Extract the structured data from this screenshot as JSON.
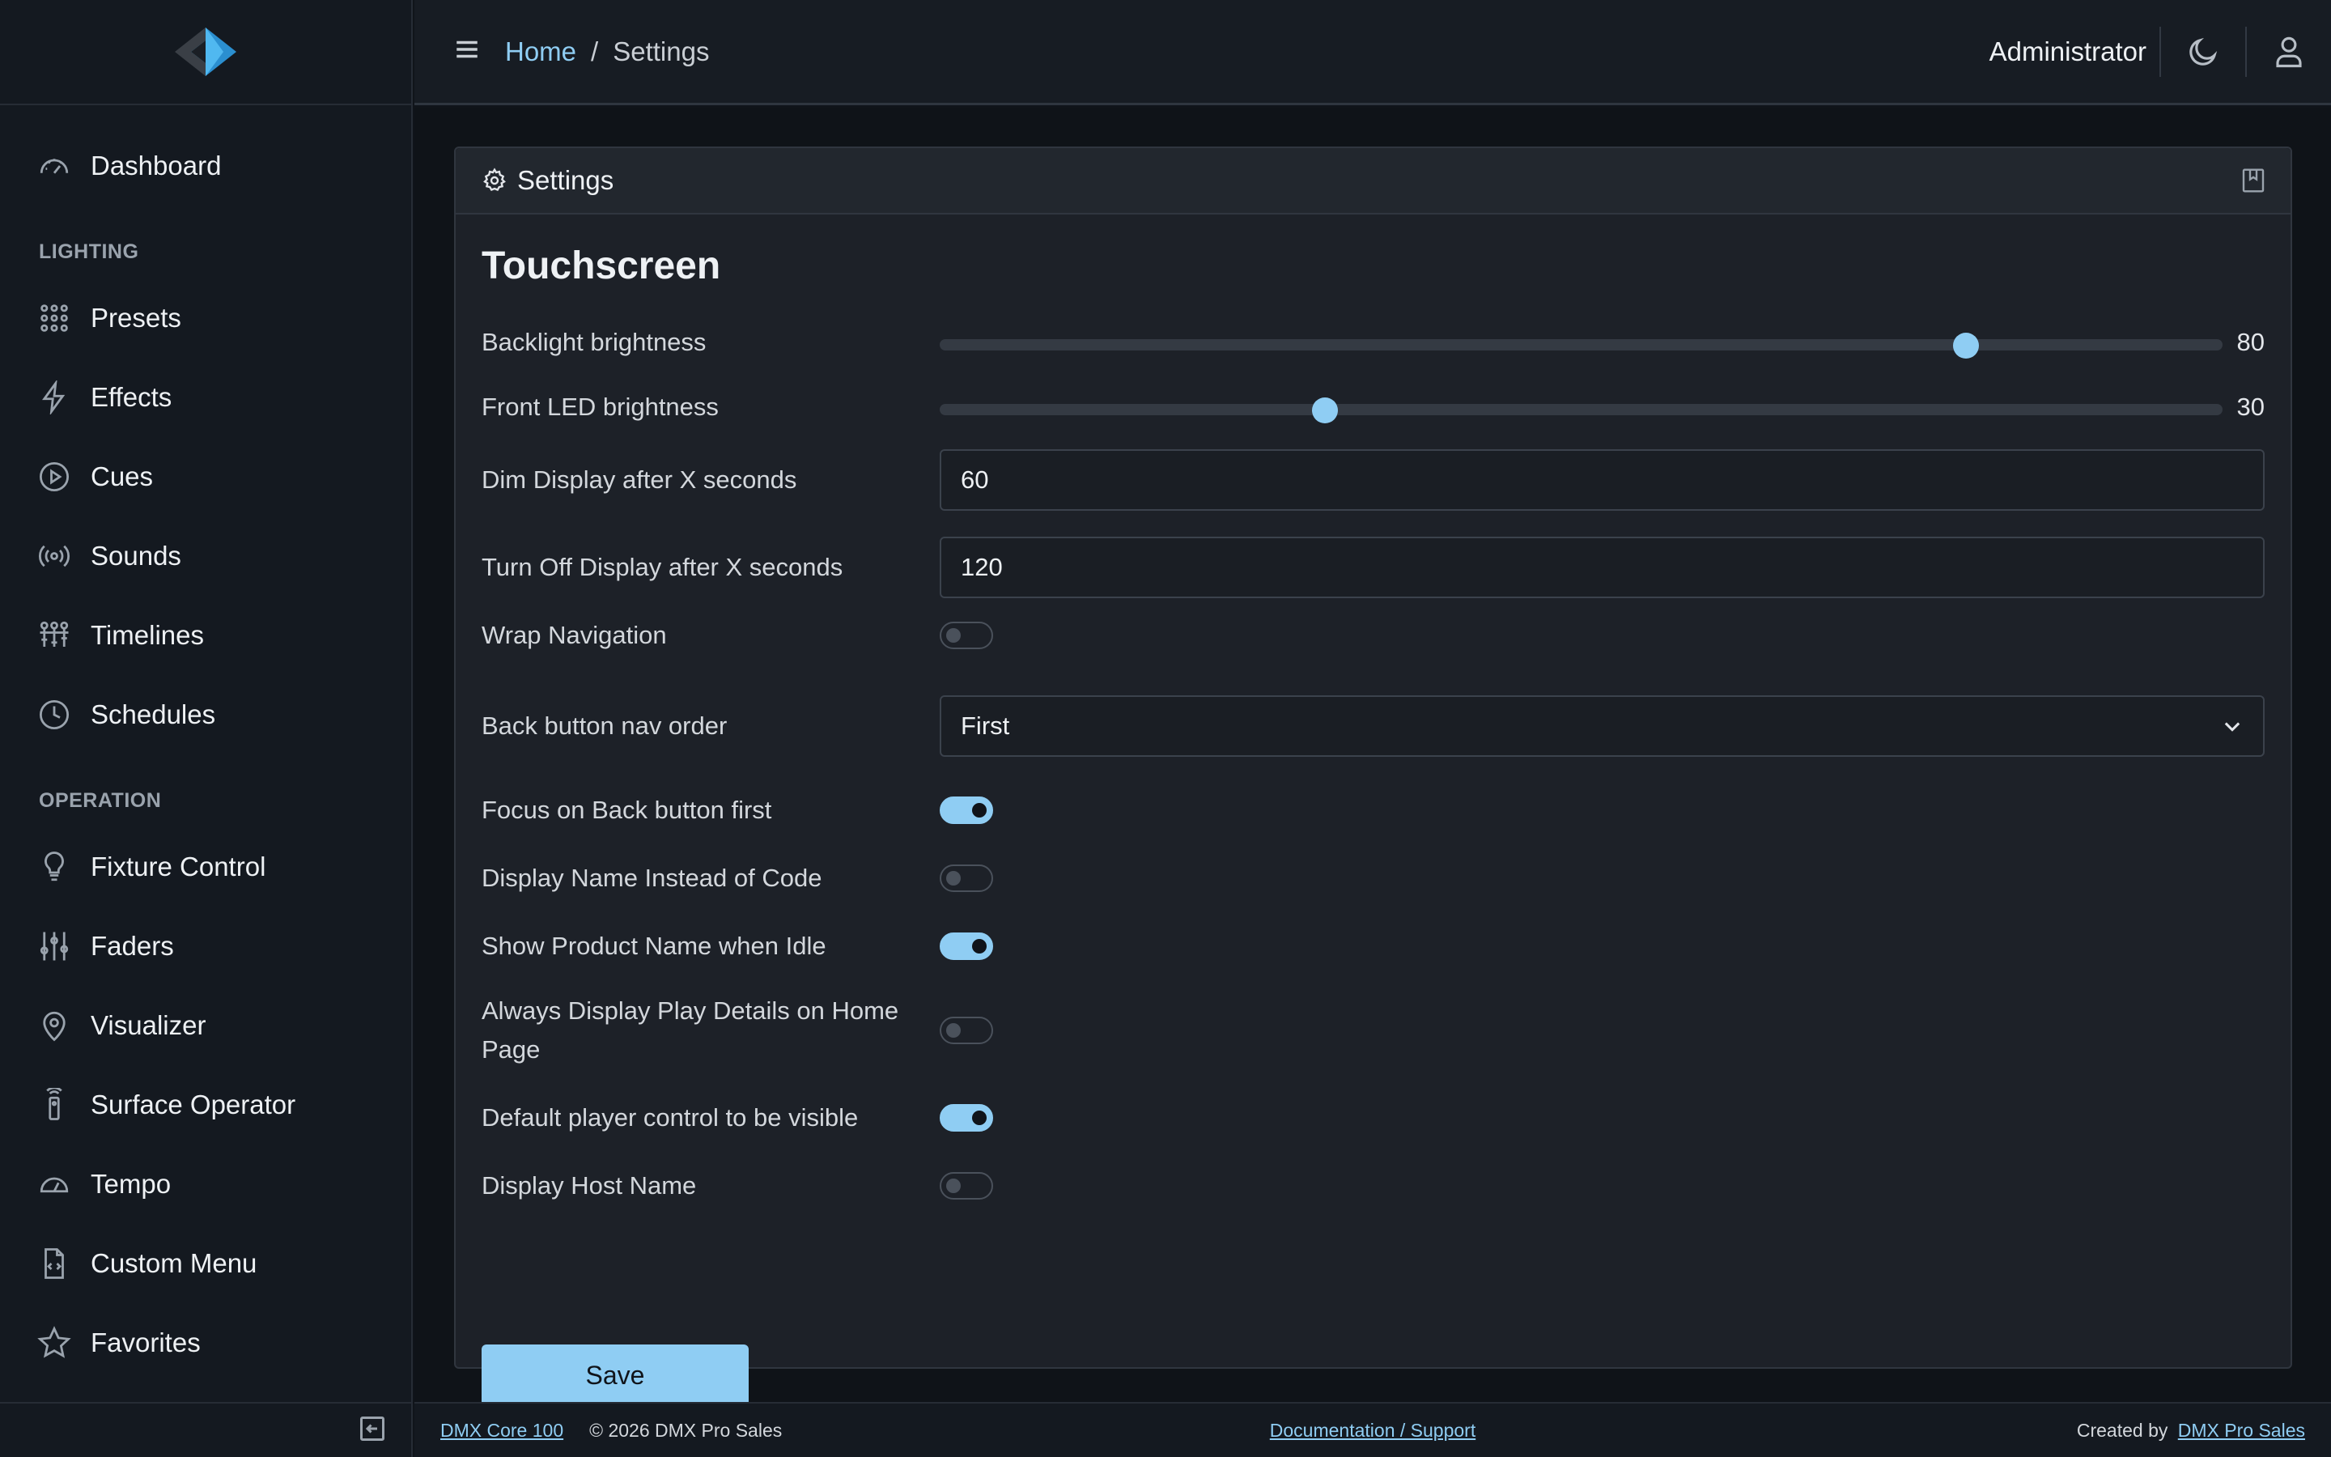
{
  "sidebar": {
    "items_top": [
      {
        "label": "Dashboard",
        "icon": "gauge-icon"
      }
    ],
    "section_lighting": "LIGHTING",
    "items_lighting": [
      {
        "label": "Presets",
        "icon": "grid-dots-icon"
      },
      {
        "label": "Effects",
        "icon": "lightning-icon"
      },
      {
        "label": "Cues",
        "icon": "play-circle-icon"
      },
      {
        "label": "Sounds",
        "icon": "broadcast-icon"
      },
      {
        "label": "Timelines",
        "icon": "timeline-icon"
      },
      {
        "label": "Schedules",
        "icon": "clock-icon"
      }
    ],
    "section_operation": "OPERATION",
    "items_operation": [
      {
        "label": "Fixture Control",
        "icon": "lightbulb-icon"
      },
      {
        "label": "Faders",
        "icon": "sliders-icon"
      },
      {
        "label": "Visualizer",
        "icon": "map-pin-icon"
      },
      {
        "label": "Surface Operator",
        "icon": "remote-icon"
      },
      {
        "label": "Tempo",
        "icon": "speedometer-icon"
      },
      {
        "label": "Custom Menu",
        "icon": "code-file-icon"
      },
      {
        "label": "Favorites",
        "icon": "star-icon"
      }
    ]
  },
  "topbar": {
    "breadcrumb_home": "Home",
    "breadcrumb_sep": "/",
    "breadcrumb_current": "Settings",
    "user": "Administrator"
  },
  "card": {
    "title": "Settings",
    "section": "Touchscreen"
  },
  "settings": {
    "backlight": {
      "label": "Backlight brightness",
      "value": 80,
      "max": 100
    },
    "front_led": {
      "label": "Front LED brightness",
      "value": 30,
      "max": 100
    },
    "dim_display": {
      "label": "Dim Display after X seconds",
      "value": "60"
    },
    "turn_off_display": {
      "label": "Turn Off Display after X seconds",
      "value": "120"
    },
    "wrap_navigation": {
      "label": "Wrap Navigation",
      "on": false
    },
    "back_nav_order": {
      "label": "Back button nav order",
      "value": "First"
    },
    "focus_back_first": {
      "label": "Focus on Back button first",
      "on": true
    },
    "display_name": {
      "label": "Display Name Instead of Code",
      "on": false
    },
    "show_product_name": {
      "label": "Show Product Name when Idle",
      "on": true
    },
    "always_play_details": {
      "label": "Always Display Play Details on Home Page",
      "on": false
    },
    "default_player_visible": {
      "label": "Default player control to be visible",
      "on": true
    },
    "display_host_name": {
      "label": "Display Host Name",
      "on": false
    }
  },
  "save_label": "Save",
  "footer": {
    "product_link": "DMX Core 100",
    "copyright": "© 2026 DMX Pro Sales",
    "docs_link": "Documentation / Support",
    "created_by": "Created by",
    "company_link": "DMX Pro Sales"
  },
  "colors": {
    "accent": "#8fcdf3",
    "background": "#0f1318",
    "card": "#1d2128"
  }
}
